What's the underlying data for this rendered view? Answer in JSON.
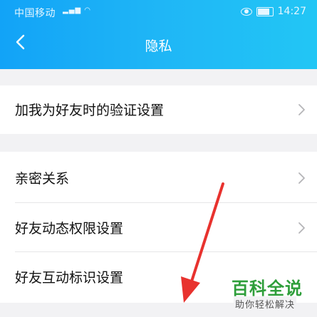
{
  "status_bar": {
    "carrier": "中国移动",
    "signal": "⁴ᴳ",
    "time": "14:27"
  },
  "header": {
    "title": "隐私"
  },
  "sections": {
    "first": {
      "items": [
        {
          "label": "加我为好友时的验证设置"
        }
      ]
    },
    "second": {
      "items": [
        {
          "label": "亲密关系"
        },
        {
          "label": "好友动态权限设置"
        },
        {
          "label": "好友互动标识设置"
        }
      ]
    }
  },
  "watermark": {
    "main": "百科全说",
    "sub": "助你轻松解决"
  },
  "colors": {
    "header_start": "#12a3f7",
    "header_end": "#22c6f5",
    "annotation_arrow": "#e8322e",
    "watermark_green": "#2e9e3a"
  }
}
